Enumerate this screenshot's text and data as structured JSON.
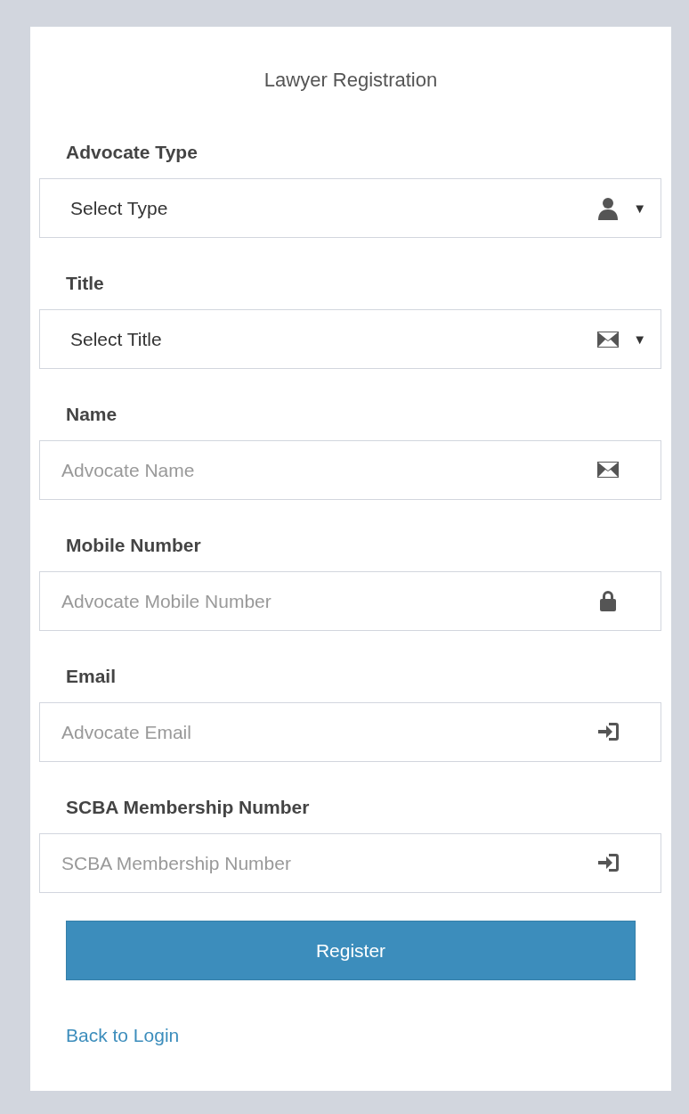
{
  "title": "Lawyer Registration",
  "fields": [
    {
      "label": "Advocate Type",
      "kind": "select",
      "value": "Select Type",
      "caret": "▼"
    },
    {
      "label": "Title",
      "kind": "select",
      "value": "Select Title",
      "caret": "▼"
    },
    {
      "label": "Name",
      "kind": "input",
      "placeholder": "Advocate Name"
    },
    {
      "label": "Mobile Number",
      "kind": "input",
      "placeholder": "Advocate Mobile Number"
    },
    {
      "label": "Email",
      "kind": "input",
      "placeholder": "Advocate Email"
    },
    {
      "label": "SCBA Membership Number",
      "kind": "input",
      "placeholder": "SCBA Membership Number"
    }
  ],
  "button": "Register",
  "link": "Back to Login"
}
